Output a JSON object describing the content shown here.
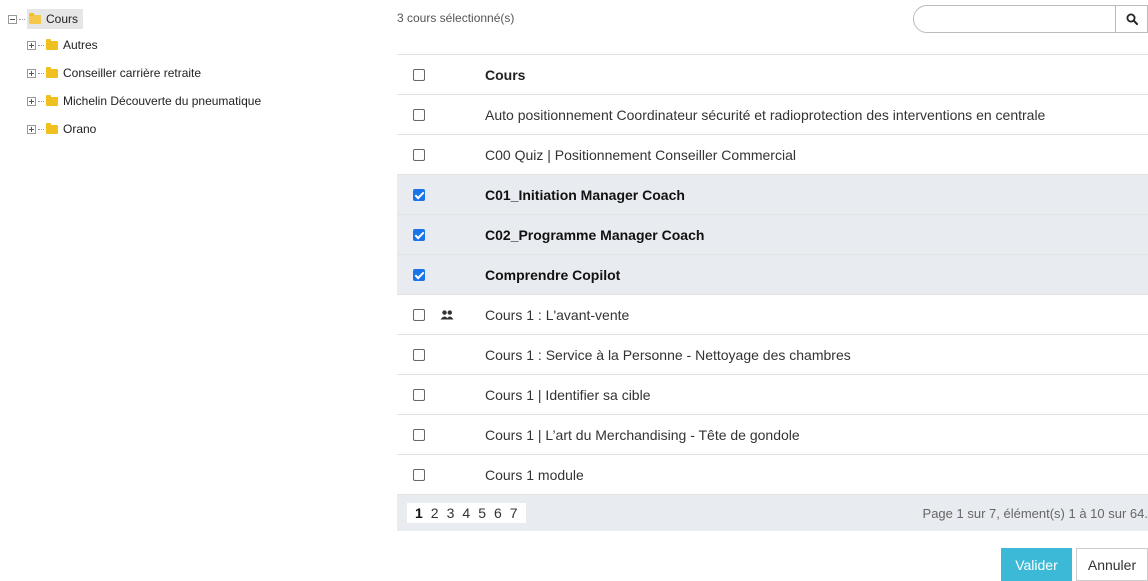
{
  "tree": {
    "root": {
      "label": "Cours"
    },
    "children": [
      {
        "label": "Autres"
      },
      {
        "label": "Conseiller carrière retraite"
      },
      {
        "label": "Michelin Découverte du pneumatique"
      },
      {
        "label": "Orano"
      }
    ]
  },
  "selection_count": "3 cours sélectionné(s)",
  "search": {
    "value": "",
    "placeholder": ""
  },
  "table": {
    "header": "Cours",
    "rows": [
      {
        "name": "Auto positionnement Coordinateur sécurité et radioprotection des interventions en centrale",
        "checked": false
      },
      {
        "name": "C00 Quiz | Positionnement Conseiller Commercial",
        "checked": false
      },
      {
        "name": "C01_Initiation Manager Coach",
        "checked": true
      },
      {
        "name": "C02_Programme Manager Coach",
        "checked": true
      },
      {
        "name": "Comprendre Copilot",
        "checked": true
      },
      {
        "name": "Cours 1 : L'avant-vente",
        "checked": false,
        "icon": "group-icon"
      },
      {
        "name": "Cours 1 : Service à la Personne - Nettoyage des chambres",
        "checked": false
      },
      {
        "name": "Cours 1 | Identifier sa cible",
        "checked": false
      },
      {
        "name": "Cours 1 | L’art du Merchandising - Tête de gondole",
        "checked": false
      },
      {
        "name": "Cours 1 module",
        "checked": false
      }
    ]
  },
  "pager": {
    "pages": [
      "1",
      "2",
      "3",
      "4",
      "5",
      "6",
      "7"
    ],
    "current": "1",
    "info": "Page 1 sur 7, élément(s) 1 à 10 sur 64."
  },
  "buttons": {
    "valider": "Valider",
    "annuler": "Annuler"
  },
  "colors": {
    "accent": "#3cb9d6",
    "checkbox": "#1a73e8",
    "selected_row": "#e8ebef",
    "folder": "#f0c020"
  }
}
